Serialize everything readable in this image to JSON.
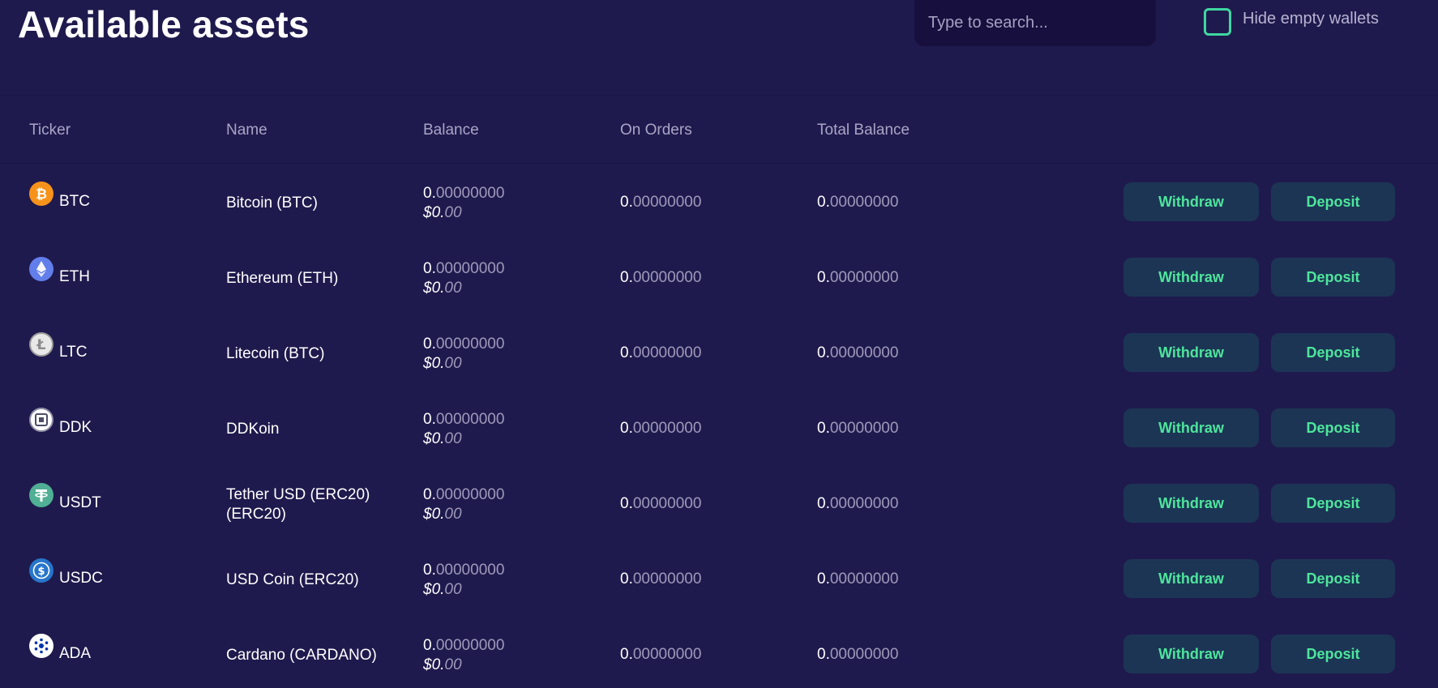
{
  "page": {
    "title": "Available assets",
    "search_placeholder": "Type to search...",
    "hide_empty_label": "Hide empty wallets"
  },
  "columns": {
    "ticker": "Ticker",
    "name": "Name",
    "balance": "Balance",
    "on_orders": "On Orders",
    "total_balance": "Total Balance"
  },
  "colors": {
    "background": "#1f1a4d",
    "button_bg": "#1c3555",
    "button_text": "#4ee59b",
    "checkbox_border": "#3fd6a0",
    "muted_text": "#9e9aba"
  },
  "actions": {
    "withdraw": "Withdraw",
    "deposit": "Deposit"
  },
  "assets": [
    {
      "ticker": "BTC",
      "name": "Bitcoin (BTC)",
      "icon": "bitcoin-icon",
      "balance_int": "0.",
      "balance_dec": "00000000",
      "usd_int": "$0.",
      "usd_dec": "00",
      "orders_int": "0.",
      "orders_dec": "00000000",
      "total_int": "0.",
      "total_dec": "00000000"
    },
    {
      "ticker": "ETH",
      "name": "Ethereum (ETH)",
      "icon": "ethereum-icon",
      "balance_int": "0.",
      "balance_dec": "00000000",
      "usd_int": "$0.",
      "usd_dec": "00",
      "orders_int": "0.",
      "orders_dec": "00000000",
      "total_int": "0.",
      "total_dec": "00000000"
    },
    {
      "ticker": "LTC",
      "name": "Litecoin (BTC)",
      "icon": "litecoin-icon",
      "balance_int": "0.",
      "balance_dec": "00000000",
      "usd_int": "$0.",
      "usd_dec": "00",
      "orders_int": "0.",
      "orders_dec": "00000000",
      "total_int": "0.",
      "total_dec": "00000000"
    },
    {
      "ticker": "DDK",
      "name": "DDKoin",
      "icon": "ddkoin-icon",
      "balance_int": "0.",
      "balance_dec": "00000000",
      "usd_int": "$0.",
      "usd_dec": "00",
      "orders_int": "0.",
      "orders_dec": "00000000",
      "total_int": "0.",
      "total_dec": "00000000"
    },
    {
      "ticker": "USDT",
      "name": "Tether USD (ERC20) (ERC20)",
      "icon": "tether-icon",
      "balance_int": "0.",
      "balance_dec": "00000000",
      "usd_int": "$0.",
      "usd_dec": "00",
      "orders_int": "0.",
      "orders_dec": "00000000",
      "total_int": "0.",
      "total_dec": "00000000"
    },
    {
      "ticker": "USDC",
      "name": "USD Coin (ERC20)",
      "icon": "usd-coin-icon",
      "balance_int": "0.",
      "balance_dec": "00000000",
      "usd_int": "$0.",
      "usd_dec": "00",
      "orders_int": "0.",
      "orders_dec": "00000000",
      "total_int": "0.",
      "total_dec": "00000000"
    },
    {
      "ticker": "ADA",
      "name": "Cardano (CARDANO)",
      "icon": "cardano-icon",
      "balance_int": "0.",
      "balance_dec": "00000000",
      "usd_int": "$0.",
      "usd_dec": "00",
      "orders_int": "0.",
      "orders_dec": "00000000",
      "total_int": "0.",
      "total_dec": "00000000"
    }
  ]
}
